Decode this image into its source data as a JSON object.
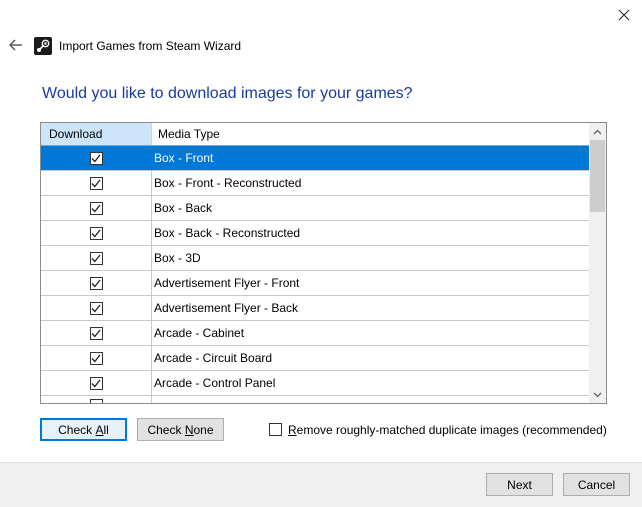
{
  "window": {
    "title": "Import Games from Steam Wizard",
    "close_icon": "close-icon",
    "back_icon": "back-arrow-icon",
    "app_icon": "steam-icon"
  },
  "heading": "Would you like to download images for your games?",
  "grid": {
    "columns": [
      "Download",
      "Media Type"
    ],
    "rows": [
      {
        "name": "Box - Front",
        "checked": true,
        "selected": true
      },
      {
        "name": "Box - Front - Reconstructed",
        "checked": true,
        "selected": false
      },
      {
        "name": "Box - Back",
        "checked": true,
        "selected": false
      },
      {
        "name": "Box - Back - Reconstructed",
        "checked": true,
        "selected": false
      },
      {
        "name": "Box - 3D",
        "checked": true,
        "selected": false
      },
      {
        "name": "Advertisement Flyer - Front",
        "checked": true,
        "selected": false
      },
      {
        "name": "Advertisement Flyer - Back",
        "checked": true,
        "selected": false
      },
      {
        "name": "Arcade - Cabinet",
        "checked": true,
        "selected": false
      },
      {
        "name": "Arcade - Circuit Board",
        "checked": true,
        "selected": false
      },
      {
        "name": "Arcade - Control Panel",
        "checked": true,
        "selected": false
      }
    ],
    "selection_color": "#0078d7"
  },
  "buttons": {
    "check_all_pre": "Check ",
    "check_all_key": "A",
    "check_all_post": "ll",
    "check_none_pre": "Check ",
    "check_none_key": "N",
    "check_none_post": "one",
    "next": "Next",
    "cancel": "Cancel"
  },
  "duplicates": {
    "label_key": "R",
    "label_rest": "emove roughly-matched duplicate images (recommended)",
    "checked": false
  },
  "colors": {
    "heading": "#1a3a9c",
    "accent": "#0078d7",
    "header_highlight": "#cce5fb"
  }
}
